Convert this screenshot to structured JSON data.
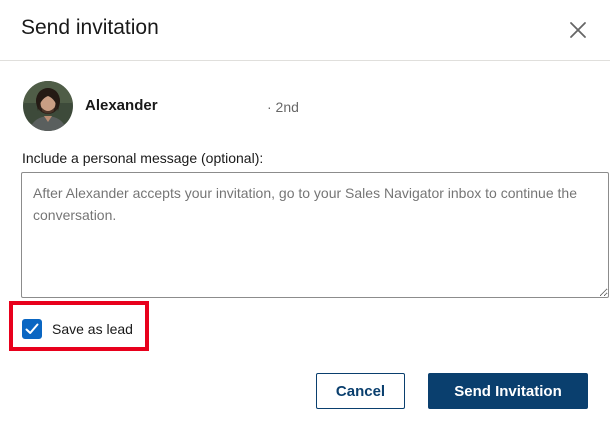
{
  "dialog": {
    "title": "Send invitation",
    "close_icon": "close-icon"
  },
  "recipient": {
    "name": "Alexander",
    "degree": "· 2nd",
    "avatar_icon": "profile-photo"
  },
  "message": {
    "label": "Include a personal message (optional):",
    "value": "",
    "placeholder": "After Alexander accepts your invitation, go to your Sales Navigator inbox to continue the conversation."
  },
  "save_as_lead": {
    "label": "Save as lead",
    "checked": true,
    "highlight_color": "#e8001c"
  },
  "actions": {
    "cancel_label": "Cancel",
    "send_label": "Send Invitation"
  },
  "colors": {
    "primary": "#0a3f6e",
    "checkbox": "#0a66c2"
  }
}
